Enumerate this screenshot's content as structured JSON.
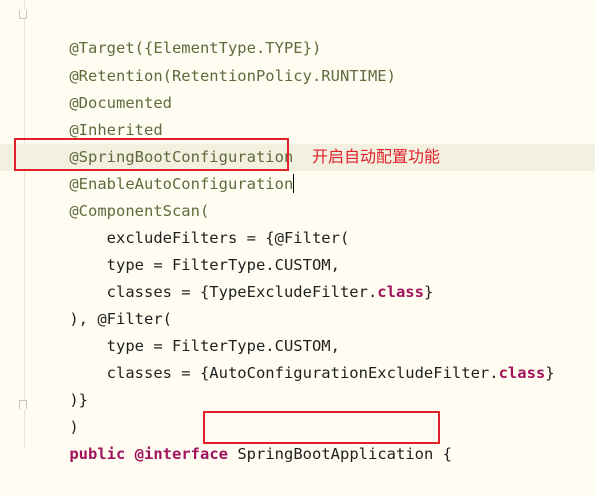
{
  "code_lines": [
    "@Target({ElementType.TYPE})",
    "@Retention(RetentionPolicy.RUNTIME)",
    "@Documented",
    "@Inherited",
    "@SpringBootConfiguration",
    "@EnableAutoConfiguration",
    "@ComponentScan(",
    "    excludeFilters = {@Filter(",
    "    type = FilterType.CUSTOM,",
    "    classes = {TypeExcludeFilter.",
    "class",
    "}",
    "), @Filter(",
    "    type = FilterType.CUSTOM,",
    "    classes = {AutoConfigurationExcludeFilter.",
    "class",
    "}",
    ")}",
    ")",
    "public",
    "@interface",
    "SpringBootApplication {"
  ],
  "callout": {
    "text": "开启自动配置功能"
  },
  "colors": {
    "background": "#FFFDF2",
    "annotation": "#5E6B3C",
    "keyword": "#A2125C",
    "highlight_box": "#E0202A"
  }
}
